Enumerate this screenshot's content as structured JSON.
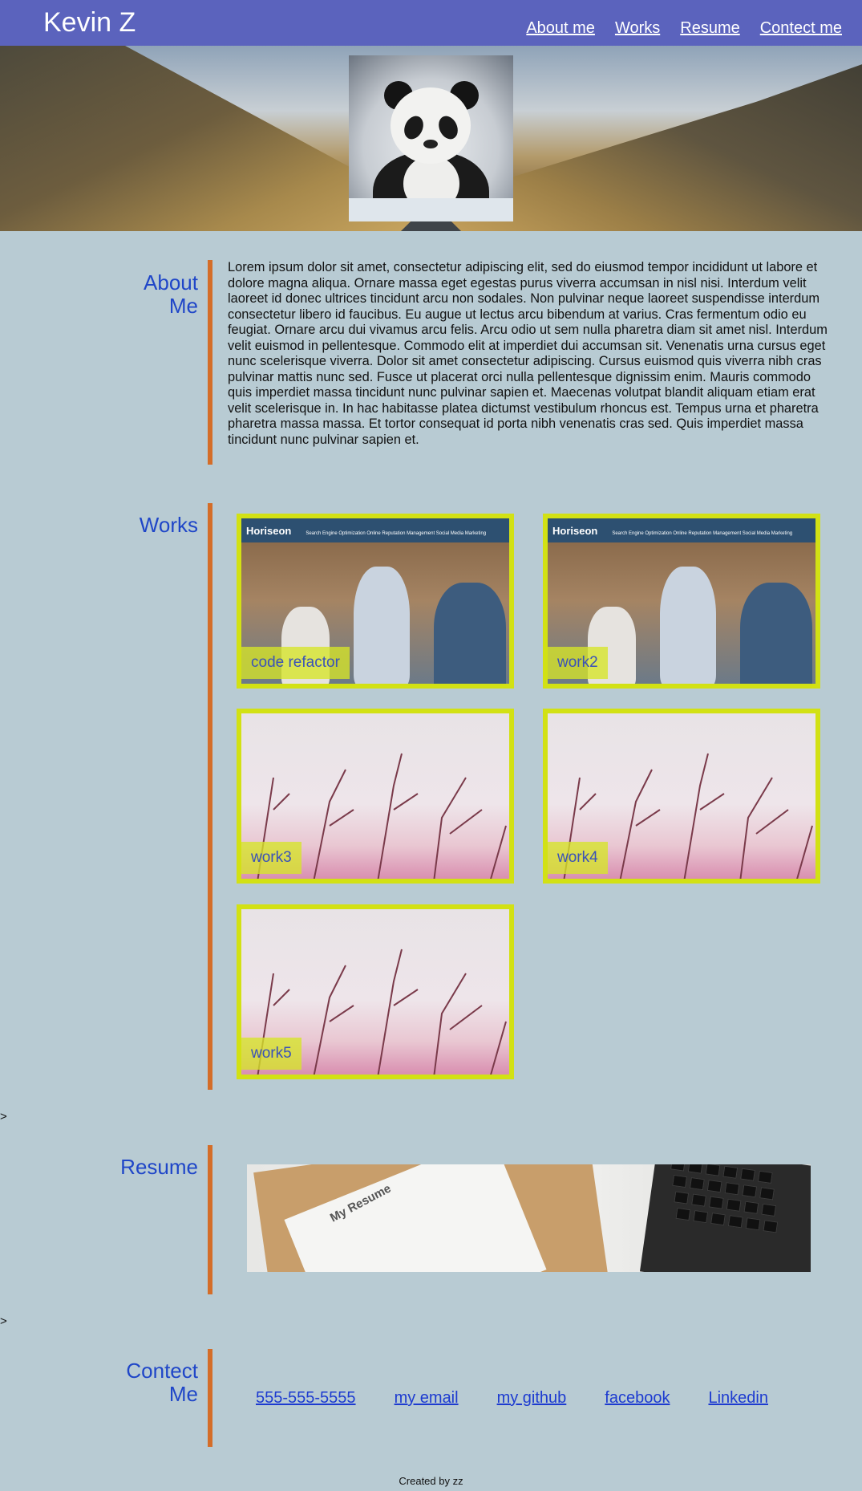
{
  "header": {
    "brand": "Kevin Z",
    "nav": [
      "About me",
      "Works",
      "Resume",
      "Contect me"
    ]
  },
  "about": {
    "title_line1": "About",
    "title_line2": "Me",
    "text": "Lorem ipsum dolor sit amet, consectetur adipiscing elit, sed do eiusmod tempor incididunt ut labore et dolore magna aliqua. Ornare massa eget egestas purus viverra accumsan in nisl nisi. Interdum velit laoreet id donec ultrices tincidunt arcu non sodales. Non pulvinar neque laoreet suspendisse interdum consectetur libero id faucibus. Eu augue ut lectus arcu bibendum at varius. Cras fermentum odio eu feugiat. Ornare arcu dui vivamus arcu felis. Arcu odio ut sem nulla pharetra diam sit amet nisl. Interdum velit euismod in pellentesque. Commodo elit at imperdiet dui accumsan sit. Venenatis urna cursus eget nunc scelerisque viverra. Dolor sit amet consectetur adipiscing. Cursus euismod quis viverra nibh cras pulvinar mattis nunc sed. Fusce ut placerat orci nulla pellentesque dignissim enim. Mauris commodo quis imperdiet massa tincidunt nunc pulvinar sapien et. Maecenas volutpat blandit aliquam etiam erat velit scelerisque in. In hac habitasse platea dictumst vestibulum rhoncus est. Tempus urna et pharetra pharetra massa massa. Et tortor consequat id porta nibh venenatis cras sed. Quis imperdiet massa tincidunt nunc pulvinar sapien et."
  },
  "works": {
    "title": "Works",
    "screenshot_brand": "Horiseon",
    "screenshot_nav": "Search Engine Optimization  Online Reputation Management  Social Media Marketing",
    "items": [
      {
        "label": "code refactor",
        "image": "horiseon-screenshot"
      },
      {
        "label": "work2",
        "image": "horiseon-screenshot"
      },
      {
        "label": "work3",
        "image": "pink-branches"
      },
      {
        "label": "work4",
        "image": "pink-branches"
      },
      {
        "label": "work5",
        "image": "pink-branches"
      }
    ],
    "border_color": "#d2e114"
  },
  "separator": ">",
  "resume": {
    "title": "Resume",
    "image_text": "My Resume"
  },
  "contact": {
    "title_line1": "Contect",
    "title_line2": "Me",
    "links": [
      "555-555-5555",
      "my email",
      "my github",
      "facebook",
      "Linkedin"
    ]
  },
  "footer": {
    "text": "Created by zz"
  },
  "colors": {
    "header_bg": "#5b63bd",
    "page_bg": "#b8cbd3",
    "accent_bar": "#d46d28",
    "title_color": "#1f46c8",
    "link_color": "#1d3bd0"
  }
}
